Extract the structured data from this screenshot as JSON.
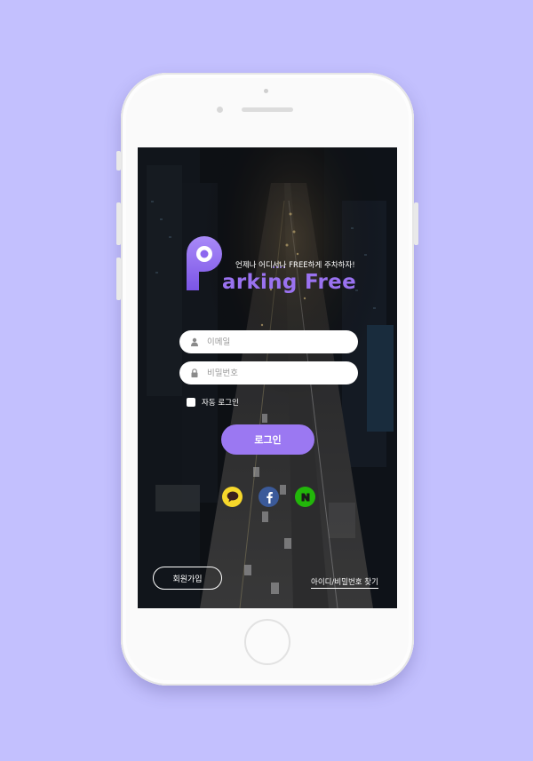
{
  "app": {
    "tagline": "언제나 어디서나 FREE하게 주차하자!",
    "brand": "arking Free",
    "logo_letter": "P",
    "accent_color": "#9b78f2"
  },
  "form": {
    "email_placeholder": "이메일",
    "password_placeholder": "비밀번호",
    "auto_login_label": "자동 로그인",
    "login_button": "로그인"
  },
  "social": [
    {
      "name": "kakao",
      "icon": "kakao-talk-bubble-icon",
      "color": "#f7d82b"
    },
    {
      "name": "facebook",
      "icon": "facebook-f-icon",
      "color": "#3b5a9a"
    },
    {
      "name": "naver",
      "icon": "naver-n-icon",
      "color": "#22b60a"
    }
  ],
  "footer": {
    "signup_label": "회원가입",
    "find_label": "아이디/비밀번호 찾기"
  }
}
